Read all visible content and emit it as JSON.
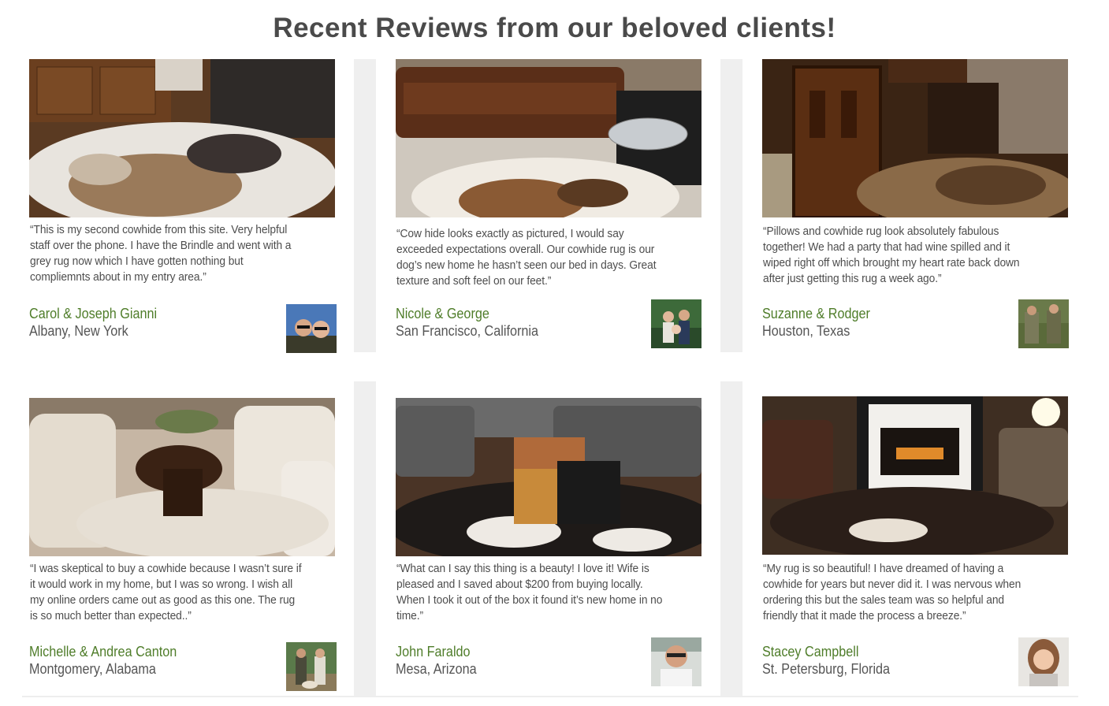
{
  "page": {
    "title": "Recent Reviews from our beloved clients!"
  },
  "reviews": [
    {
      "quote": "“This is my second cowhide from this site. Very helpful staff over the phone. I have the Brindle and went with a grey rug now which I have gotten nothing but compliemnts about in my entry area.”",
      "name": "Carol & Joseph Gianni",
      "location": "Albany, New York"
    },
    {
      "quote": "“Cow hide looks exactly as pictured, I would say exceeded expectations overall. Our cowhide rug is our dog’s new home he hasn’t seen our bed in days. Great texture and soft feel on our feet.”",
      "name": "Nicole & George",
      "location": "San Francisco, California"
    },
    {
      "quote": "“Pillows and cowhide rug look absolutely fabulous together! We had a party that had wine spilled and it wiped right off which brought my heart rate back down after just getting this rug a week ago.”",
      "name": "Suzanne & Rodger",
      "location": "Houston, Texas"
    },
    {
      "quote": "“I was skeptical to buy a cowhide because I wasn’t sure if it would work in my home, but I was so wrong. I wish all my online orders came out as good as this one. The rug is so much better than expected..”",
      "name": "Michelle & Andrea Canton",
      "location": "Montgomery, Alabama"
    },
    {
      "quote": "“What can I say this thing is a beauty! I love it! Wife is pleased and I saved about $200 from buying locally. When I took it out of the box it found it’s new home in no time.”",
      "name": "John Faraldo",
      "location": "Mesa, Arizona"
    },
    {
      "quote": "“My rug is so beautiful! I have dreamed of having a cowhide for years but never did it. I was nervous when ordering this but the sales team was so helpful and friendly that it made the process a breeze.”",
      "name": "Stacey Campbell",
      "location": "St. Petersburg, Florida"
    }
  ],
  "colors": {
    "title": "#4a4a4a",
    "name": "#4f7d2a",
    "text": "#4d4d4d",
    "divider": "#efefef"
  }
}
